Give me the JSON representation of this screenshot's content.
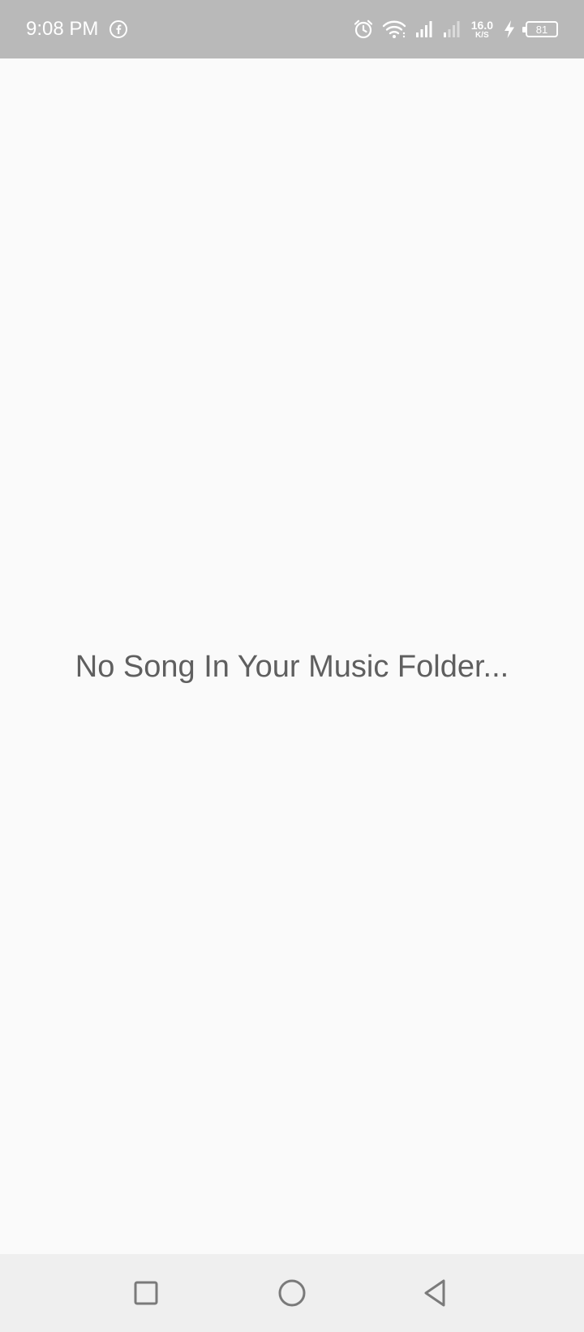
{
  "status_bar": {
    "time": "9:08 PM",
    "notification_icon": "facebook-icon",
    "icons": [
      "alarm-icon",
      "wifi-icon",
      "signal-icon",
      "signal-weak-icon",
      "charging-icon"
    ],
    "net_speed_value": "16.0",
    "net_speed_unit": "K/S",
    "battery_level": "81"
  },
  "main": {
    "empty_message": "No Song In Your Music Folder..."
  },
  "nav_bar": {
    "buttons": [
      "recents-icon",
      "home-icon",
      "back-icon"
    ]
  },
  "colors": {
    "status_bar_bg": "#b9b9b9",
    "background": "#fafafa",
    "nav_bar_bg": "#efefef",
    "message_text": "#5f5f5f"
  }
}
